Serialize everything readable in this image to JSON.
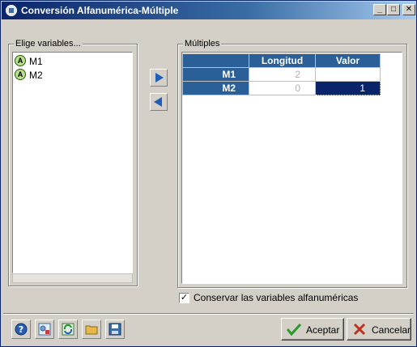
{
  "window": {
    "title": "Conversión Alfanumérica-Múltiple",
    "controls": {
      "minimize": "_",
      "maximize": "□",
      "close": "✕"
    }
  },
  "left_panel": {
    "label": "Elige variables...",
    "variables": [
      {
        "badge": "A",
        "name": "M1"
      },
      {
        "badge": "A",
        "name": "M2"
      }
    ]
  },
  "transfer": {
    "add_icon": "arrow-right-icon",
    "remove_icon": "arrow-left-icon"
  },
  "right_panel": {
    "label": "Múltiples",
    "columns": [
      "",
      "Longitud",
      "Valor"
    ],
    "rows": [
      {
        "name": "M1",
        "longitud": "2",
        "valor": ""
      },
      {
        "name": "M2",
        "longitud": "0",
        "valor": "1"
      }
    ]
  },
  "options": {
    "keep_alpha_vars_label": "Conservar las variables alfanuméricas",
    "keep_alpha_vars_checked": true,
    "check_mark": "✓"
  },
  "footer": {
    "tools": [
      "help-icon",
      "settings-icon",
      "refresh-icon",
      "open-folder-icon",
      "save-icon"
    ],
    "accept_label": "Aceptar",
    "cancel_label": "Cancelar"
  },
  "colors": {
    "title_start": "#0a246a",
    "grid_header": "#2b5f98",
    "selection": "#0a246a",
    "arrow": "#1f5fb7"
  }
}
